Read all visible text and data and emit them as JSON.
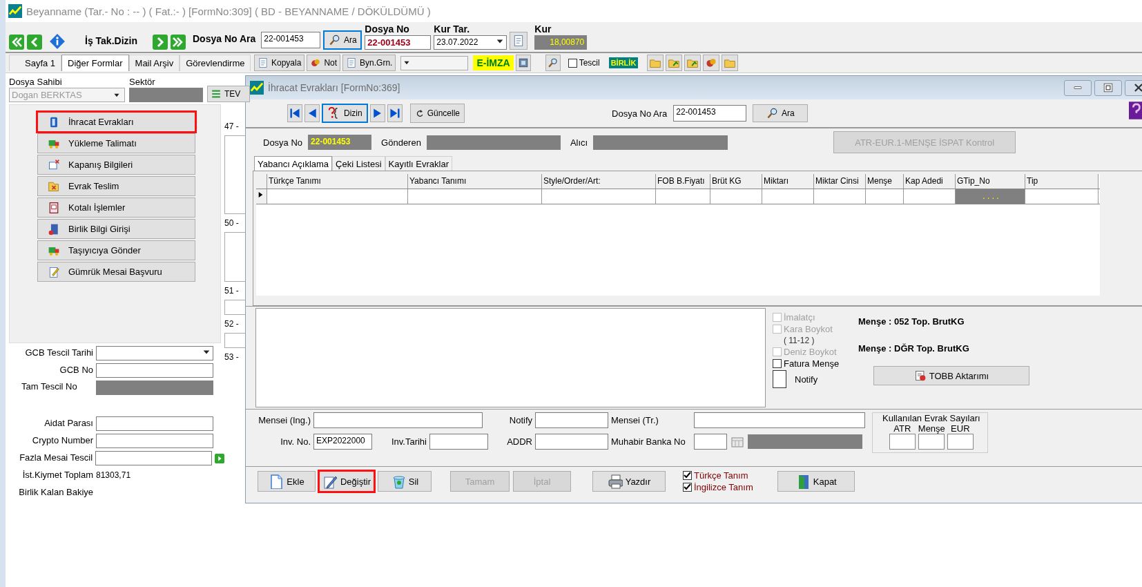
{
  "window": {
    "title": "Beyanname (Tar.- No :  --  ) ( Fat.:- )  [FormNo:309] ( BD - BEYANNAME / DÖKÜLDÜMÜ )"
  },
  "toolbar": {
    "task_label": "İş Tak.Dizin",
    "search_label": "Dosya No Ara",
    "search_value": "22-001453",
    "search_button": "Ara",
    "file_label": "Dosya No",
    "file_value": "22-001453",
    "date_label": "Kur Tar.",
    "date_value": "23.07.2022",
    "rate_label": "Kur",
    "rate_value": "18,00870"
  },
  "tabs": [
    {
      "label": "Sayfa 1",
      "selected": false
    },
    {
      "label": "Diğer Formlar",
      "selected": true
    },
    {
      "label": "Mail Arşiv",
      "selected": false
    },
    {
      "label": "Görevlendirme",
      "selected": false
    }
  ],
  "tab_tools": {
    "buttons": [
      "Kopyala",
      "Not",
      "Byn.Grn."
    ],
    "esign": "E-İMZA",
    "register": {
      "label": "Tescil",
      "checked": false
    },
    "logo": "BİRLİK"
  },
  "left_panel": {
    "owner_label": "Dosya Sahibi",
    "owner_value": "Dogan BERKTAS",
    "sector_label": "Sektör",
    "tev_button": "TEV",
    "forms": [
      {
        "label": "İhracat Evrakları",
        "highlighted": true
      },
      {
        "label": "Yükleme Talimatı",
        "highlighted": false
      },
      {
        "label": "Kapanış Bilgileri",
        "highlighted": false
      },
      {
        "label": "Evrak Teslim",
        "highlighted": false
      },
      {
        "label": "Kotalı İşlemler",
        "highlighted": false
      },
      {
        "label": "Birlik Bilgi Girişi",
        "highlighted": false
      },
      {
        "label": "Taşıyıcıya Gönder",
        "highlighted": false
      },
      {
        "label": "Gümrük Mesai Başvuru",
        "highlighted": false
      }
    ],
    "side_labels": [
      "47 -",
      "50 -",
      "51 -",
      "52 -",
      "53 -"
    ],
    "fields": [
      {
        "kind": "combo",
        "label": "GCB Tescil Tarihi"
      },
      {
        "kind": "input",
        "label": "GCB No"
      },
      {
        "kind": "readonly",
        "label": "Tam Tescil No"
      },
      {
        "kind": "input",
        "label": "Aidat Parası"
      },
      {
        "kind": "input",
        "label": "Crypto Number"
      },
      {
        "kind": "input_go",
        "label": "Fazla Mesai Tescil"
      },
      {
        "kind": "value",
        "label": "İst.Kiymet Toplam",
        "value": "81303,71"
      },
      {
        "kind": "value",
        "label": "Birlik Kalan Bakiye"
      }
    ]
  },
  "dialog": {
    "title": "İhracat Evrakları [FormNo:369]",
    "index_button": "Dizin",
    "refresh_button": "Güncelle",
    "search_label": "Dosya No Ara",
    "search_value": "22-001453",
    "search_button": "Ara",
    "file_label": "Dosya No",
    "file_value": "22-001453",
    "sender_label": "Gönderen",
    "receiver_label": "Alıcı",
    "check_button": {
      "label": "ATR-EUR.1-MENŞE İSPAT Kontrol",
      "disabled": true
    },
    "tabs": [
      {
        "label": "Yabancı Açıklama",
        "selected": true
      },
      {
        "label": "Çeki Listesi",
        "selected": false
      },
      {
        "label": "Kayıtlı Evraklar",
        "selected": false
      }
    ],
    "grid": {
      "columns": [
        "Türkçe Tanımı",
        "Yabancı Tanımı",
        "Style/Order/Art:",
        "FOB B.Fiyatı",
        "Brüt KG",
        "Miktarı",
        "Miktar Cinsi",
        "Menşe",
        "Kap Adedi",
        "GTip_No",
        "Tip"
      ],
      "rows": [
        {
          "current": true,
          "gtip_no": ". . . ."
        }
      ]
    },
    "options": [
      {
        "kind": "checkbox",
        "label": "İmalatçı",
        "checked": false,
        "disabled": true
      },
      {
        "kind": "checkbox",
        "label": "Kara Boykot",
        "note": "( 11-12 )",
        "checked": false,
        "disabled": true
      },
      {
        "kind": "checkbox",
        "label": "Deniz Boykot",
        "checked": false,
        "disabled": true
      },
      {
        "kind": "checkbox",
        "label": "Fatura Menşe",
        "checked": false,
        "disabled": false
      },
      {
        "kind": "large",
        "label": "Notify",
        "checked": false,
        "disabled": false
      }
    ],
    "totals": [
      "Menşe : 052  Top. BrutKG",
      "Menşe : DĞR  Top. BrutKG"
    ],
    "tobb_button": "TOBB Aktarımı",
    "fields": {
      "origin_en": "Mensei (Ing.)",
      "notify": "Notify",
      "origin_tr": "Mensei (Tr.)",
      "inv_no": "Inv. No.",
      "inv_no_value": "EXP2022000",
      "inv_date": "Inv.Tarihi",
      "addr": "ADDR",
      "bank": "Muhabir Banka No"
    },
    "doc_counts": {
      "title": "Kullanılan Evrak Sayıları",
      "columns": [
        "ATR",
        "Menşe",
        "EUR"
      ]
    },
    "buttons": [
      {
        "label": "Ekle",
        "disabled": false,
        "highlighted": false
      },
      {
        "label": "Değiştir",
        "disabled": false,
        "highlighted": true
      },
      {
        "label": "Sil",
        "disabled": false,
        "highlighted": false
      },
      {
        "label": "Tamam",
        "disabled": true,
        "highlighted": false
      },
      {
        "label": "İptal",
        "disabled": true,
        "highlighted": false
      },
      {
        "label": "Yazdır",
        "disabled": false,
        "highlighted": false
      }
    ],
    "print_options": [
      {
        "label": "Türkçe Tanım",
        "checked": true
      },
      {
        "label": "İngilizce Tanım",
        "checked": true
      }
    ],
    "close_button": "Kapat"
  }
}
